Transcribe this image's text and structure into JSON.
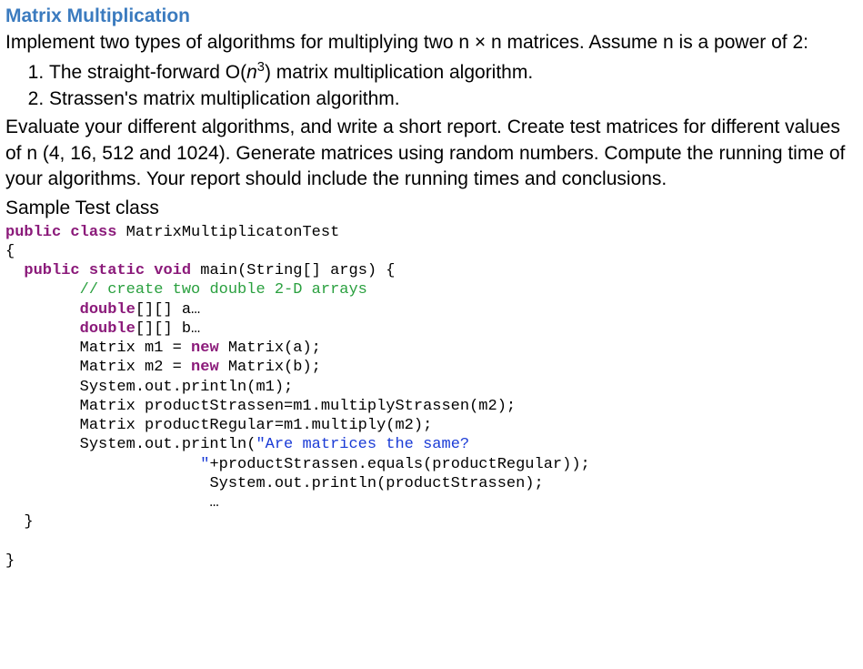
{
  "title": "Matrix Multiplication",
  "intro": "Implement two types of algorithms for multiplying two n × n matrices. Assume n is a power of 2:",
  "item1_pre": "The straight-forward O(",
  "item1_var": "n",
  "item1_exp": "3",
  "item1_post": ") matrix multiplication algorithm.",
  "item2": "Strassen's matrix multiplication algorithm.",
  "eval_text": "Evaluate your different algorithms, and write a short report. Create test matrices for different values of n (4, 16, 512 and 1024). Generate matrices using random numbers. Compute the running time of your algorithms. Your report should include the running times and conclusions.",
  "sample_label": "Sample Test class",
  "code": {
    "kw_public1": "public",
    "kw_class": "class",
    "class_name": " MatrixMultiplicatonTest",
    "brace_open1": "{",
    "indent1": "  ",
    "kw_public2": "public",
    "kw_static": "static",
    "kw_void": "void",
    "main_sig1": " main(String[] args) {",
    "indent2": "        ",
    "comment1": "// create two double 2-D arrays",
    "kw_double1": "double",
    "arr_a": "[][] a…",
    "kw_double2": "double",
    "arr_b": "[][] b…",
    "line_m1a": "        Matrix m1 = ",
    "kw_new1": "new",
    "line_m1b": " Matrix(a);",
    "line_m2a": "        Matrix m2 = ",
    "kw_new2": "new",
    "line_m2b": " Matrix(b);",
    "line_print_m1": "        System.out.println(m1);",
    "line_strassen": "        Matrix productStrassen=m1.multiplyStrassen(m2);",
    "line_regular": "        Matrix productRegular=m1.multiply(m2);",
    "line_print2a": "        System.out.println(",
    "str_part1": "\"Are matrices the same?",
    "str_indent": "                     ",
    "str_part2": "\"",
    "line_print2b": "+productStrassen.equals(productRegular));",
    "line_print3_indent": "                      ",
    "line_print3": "System.out.println(productStrassen);",
    "ellipsis_indent": "                      ",
    "ellipsis": "…",
    "brace_close_inner": "  }",
    "brace_close_outer": "}"
  }
}
